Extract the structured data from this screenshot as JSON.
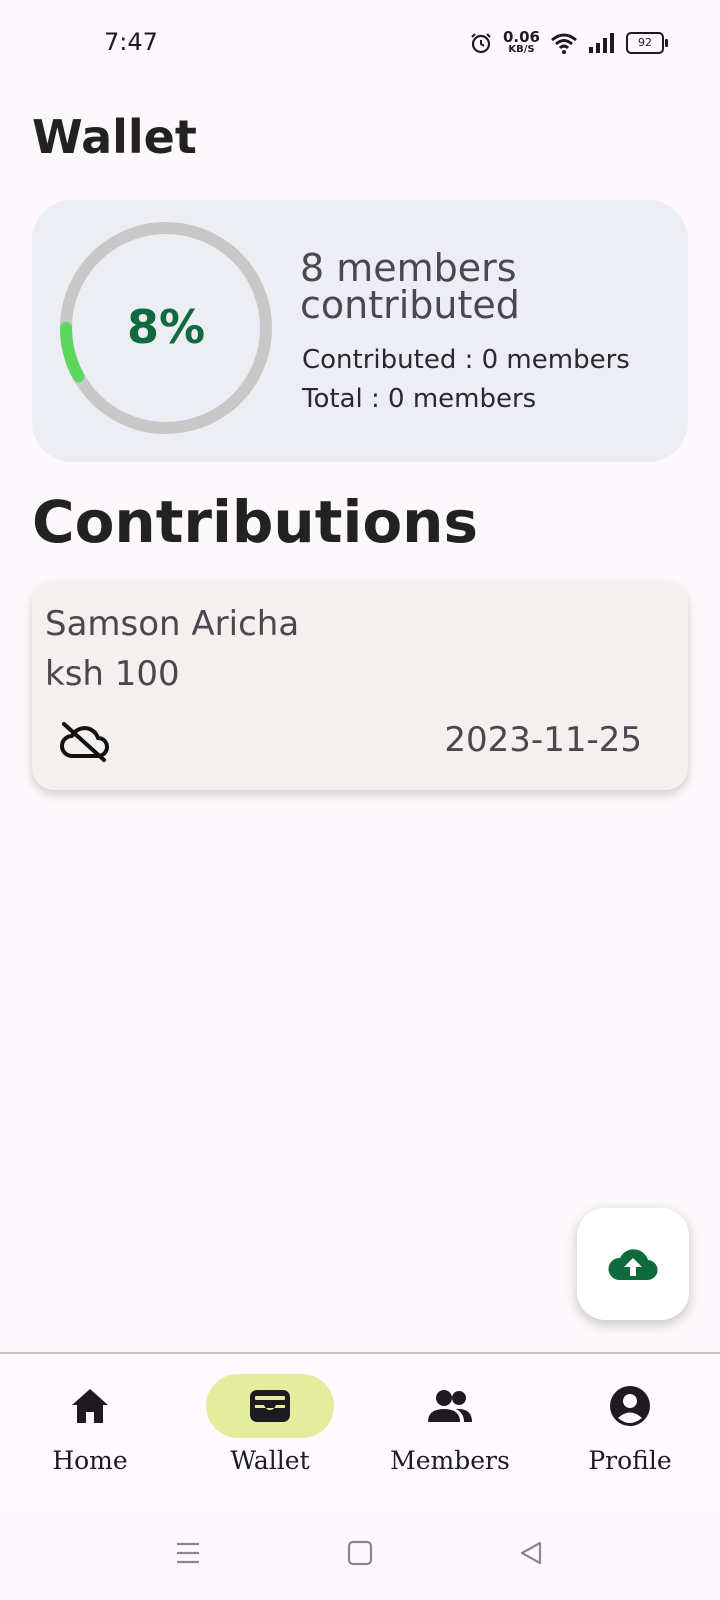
{
  "status_bar": {
    "time": "7:47",
    "net_speed_value": "0.06",
    "net_speed_unit": "KB/S",
    "battery": "92",
    "icons": [
      "alarm-icon",
      "wifi-icon",
      "signal-icon",
      "battery-icon"
    ]
  },
  "page": {
    "title": "Wallet"
  },
  "summary": {
    "percent_label": "8%",
    "progress": 0.08,
    "headline": "8 members contributed",
    "contributed_line": "Contributed : 0 members",
    "total_line": "Total : 0 members",
    "colors": {
      "progress": "#5cd65c",
      "track": "#c8c8c8",
      "percent_text": "#0f6b3e",
      "card_bg": "#eceef4"
    }
  },
  "contributions": {
    "title": "Contributions",
    "items": [
      {
        "name": "Samson Aricha",
        "amount": "ksh 100",
        "date": "2023-11-25",
        "status_icon": "cloud-off-icon"
      }
    ]
  },
  "fab": {
    "icon": "cloud-upload-icon",
    "color": "#0f6b3e"
  },
  "bottom_nav": {
    "active": "Wallet",
    "active_color": "#e2ed9e",
    "items": [
      {
        "label": "Home",
        "icon": "home-icon"
      },
      {
        "label": "Wallet",
        "icon": "wallet-icon"
      },
      {
        "label": "Members",
        "icon": "people-icon"
      },
      {
        "label": "Profile",
        "icon": "account-circle-icon"
      }
    ]
  },
  "system_nav": {
    "icons": [
      "menu-icon",
      "home-square-icon",
      "back-icon"
    ]
  }
}
